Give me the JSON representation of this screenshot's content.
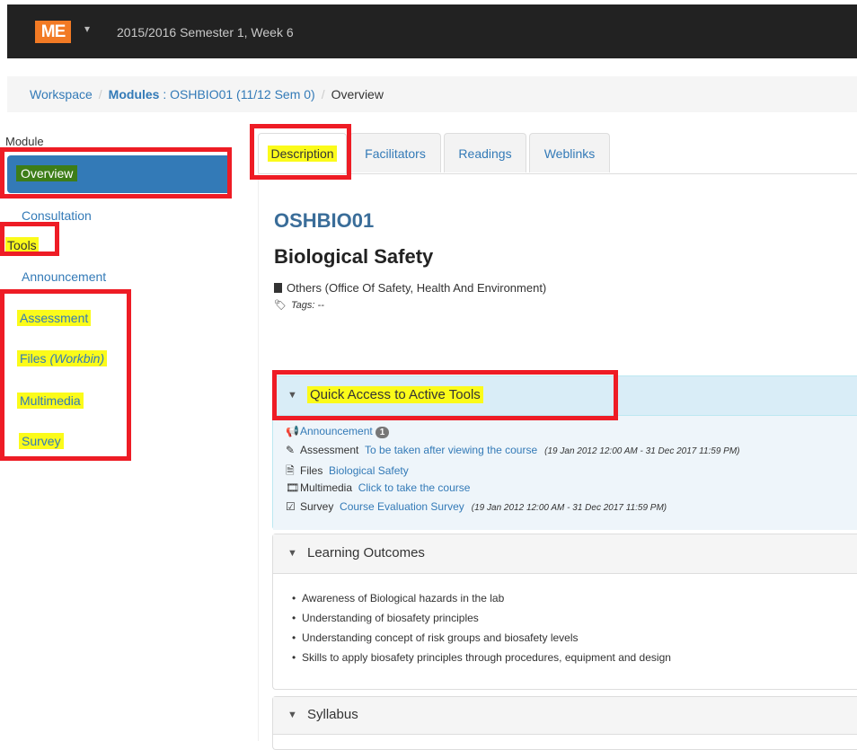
{
  "navbar": {
    "logo": "ME",
    "caret": "▾",
    "semester": "2015/2016 Semester 1, Week 6"
  },
  "breadcrumb": {
    "workspace": "Workspace",
    "modules_label": "Modules",
    "module_ref": " : OSHBIO01 (11/12 Sem 0)",
    "current": "Overview"
  },
  "sidebar": {
    "header": "Module",
    "active": "Overview",
    "consultation": "Consultation",
    "tools_header": "Tools",
    "announcement": "Announcement",
    "assessment": "Assessment",
    "files": "Files ",
    "files_sub": "(Workbin)",
    "multimedia": "Multimedia",
    "survey": "Survey"
  },
  "tabs": [
    "Description",
    "Facilitators",
    "Readings",
    "Weblinks"
  ],
  "module": {
    "code": "OSHBIO01",
    "title": "Biological Safety",
    "department": "Others (Office Of Safety, Health And Environment)",
    "tags": "Tags: --"
  },
  "quick_access": {
    "title": "Quick Access to Active Tools",
    "announcement": {
      "label": "Announcement",
      "count": "1"
    },
    "assessment": {
      "label": "Assessment",
      "link": "To be taken after viewing the course",
      "dates": "(19 Jan 2012 12:00 AM - 31 Dec 2017 11:59 PM)"
    },
    "files": {
      "label": "Files",
      "link": "Biological Safety"
    },
    "multimedia": {
      "label": "Multimedia",
      "link": "Click to take the course"
    },
    "survey": {
      "label": "Survey",
      "link": "Course Evaluation Survey",
      "dates": "(19 Jan 2012 12:00 AM - 31 Dec 2017 11:59 PM)"
    }
  },
  "learning_outcomes": {
    "title": "Learning Outcomes",
    "items": [
      "Awareness of Biological hazards in the lab",
      "Understanding of biosafety principles",
      "Understanding concept of risk groups and biosafety levels",
      "Skills to apply biosafety principles through procedures, equipment and design"
    ]
  },
  "syllabus": {
    "title": "Syllabus"
  },
  "colors": {
    "highlight": "#fbfb1a",
    "annotation_box": "#ee1c25",
    "accent": "#337ab7",
    "logo": "#f27a24"
  }
}
